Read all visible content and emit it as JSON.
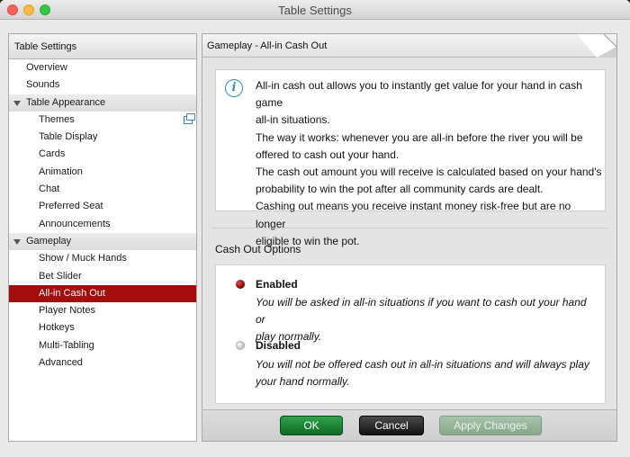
{
  "window": {
    "title": "Table Settings"
  },
  "sidebar": {
    "header": "Table Settings",
    "items": [
      {
        "label": "Overview",
        "type": "item",
        "level": 1
      },
      {
        "label": "Sounds",
        "type": "item",
        "level": 1
      },
      {
        "label": "Table Appearance",
        "type": "group"
      },
      {
        "label": "Themes",
        "type": "item",
        "level": 2,
        "icon": "external-window-icon"
      },
      {
        "label": "Table Display",
        "type": "item",
        "level": 2
      },
      {
        "label": "Cards",
        "type": "item",
        "level": 2
      },
      {
        "label": "Animation",
        "type": "item",
        "level": 2
      },
      {
        "label": "Chat",
        "type": "item",
        "level": 2
      },
      {
        "label": "Preferred Seat",
        "type": "item",
        "level": 2
      },
      {
        "label": "Announcements",
        "type": "item",
        "level": 2
      },
      {
        "label": "Gameplay",
        "type": "group"
      },
      {
        "label": "Show / Muck Hands",
        "type": "item",
        "level": 2
      },
      {
        "label": "Bet Slider",
        "type": "item",
        "level": 2
      },
      {
        "label": "All-in Cash Out",
        "type": "item",
        "level": 2,
        "selected": true
      },
      {
        "label": "Player Notes",
        "type": "item",
        "level": 2
      },
      {
        "label": "Hotkeys",
        "type": "item",
        "level": 2
      },
      {
        "label": "Multi-Tabling",
        "type": "item",
        "level": 2
      },
      {
        "label": "Advanced",
        "type": "item",
        "level": 2
      }
    ]
  },
  "main": {
    "header": "Gameplay - All-in Cash Out",
    "info": {
      "icon": "info-icon",
      "lines": [
        "All-in cash out allows you to instantly get value for your hand in cash game",
        "all-in situations.",
        "The way it works: whenever you are all-in before the river you will be",
        "offered to cash out your hand.",
        "The cash out amount you will receive is calculated based on your hand's",
        "probability to win the pot after all community cards are dealt.",
        "Cashing out means you receive instant money risk-free but are no longer",
        "eligible to win the pot."
      ]
    },
    "section_label": "Cash Out Options",
    "options": [
      {
        "title": "Enabled",
        "selected": true,
        "desc_lines": [
          "You will be asked in all-in situations if you want to cash out your hand or",
          "play normally."
        ]
      },
      {
        "title": "Disabled",
        "selected": false,
        "desc_lines": [
          "You will not be offered cash out in all-in situations and will always play",
          "your hand normally."
        ]
      }
    ]
  },
  "footer": {
    "ok_label": "OK",
    "cancel_label": "Cancel",
    "apply_label": "Apply Changes"
  },
  "colors": {
    "selected_bg": "#a40d0c",
    "ok_green": "#1f8a38",
    "info_blue": "#2e8fb9"
  }
}
